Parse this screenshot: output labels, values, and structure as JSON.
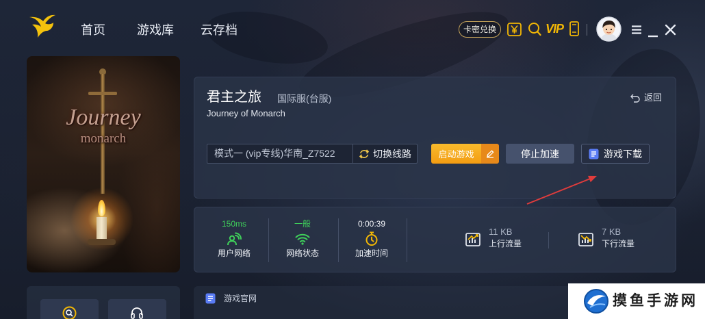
{
  "app": {
    "logo_icon": "flame-bird-logo"
  },
  "nav": {
    "items": [
      {
        "label": "首页"
      },
      {
        "label": "游戏库"
      },
      {
        "label": "云存档"
      }
    ]
  },
  "topbar": {
    "redeem_label": "卡密兑换",
    "vip_label": "VIP",
    "icons": [
      "yuan-icon",
      "search-icon",
      "vip-icon",
      "mobile-icon",
      "avatar",
      "menu-icon",
      "minimize-icon",
      "close-icon"
    ]
  },
  "cover": {
    "art_line1": "Journey",
    "art_line2": "monarch"
  },
  "game": {
    "title": "君主之旅",
    "server": "国际服(台服)",
    "subtitle": "Journey of Monarch",
    "back_label": "返回"
  },
  "route": {
    "current": "模式一 (vip专线)华南_Z7522",
    "switch_label": "切换线路"
  },
  "actions": {
    "start_label": "启动游戏",
    "stop_label": "停止加速",
    "download_label": "游戏下载"
  },
  "stats": {
    "user_network": {
      "value": "150ms",
      "label": "用户网络"
    },
    "network_status": {
      "value": "一般",
      "label": "网络状态"
    },
    "boost_time": {
      "value": "0:00:39",
      "label": "加速时间"
    },
    "upload": {
      "value": "11 KB",
      "label": "上行流量"
    },
    "download": {
      "value": "7 KB",
      "label": "下行流量"
    }
  },
  "links": {
    "official_site_label": "游戏官网"
  },
  "side_buttons": {
    "icons": [
      "search-circle-icon",
      "headset-icon"
    ]
  },
  "watermark": {
    "text": "摸鱼手游网"
  },
  "colors": {
    "background": "#1b2233",
    "card": "#2a3449",
    "accent_orange": "#f5a623",
    "accent_yellow": "#f2b705",
    "status_green": "#3fcf5a",
    "annotation_red": "#e03c3c"
  }
}
